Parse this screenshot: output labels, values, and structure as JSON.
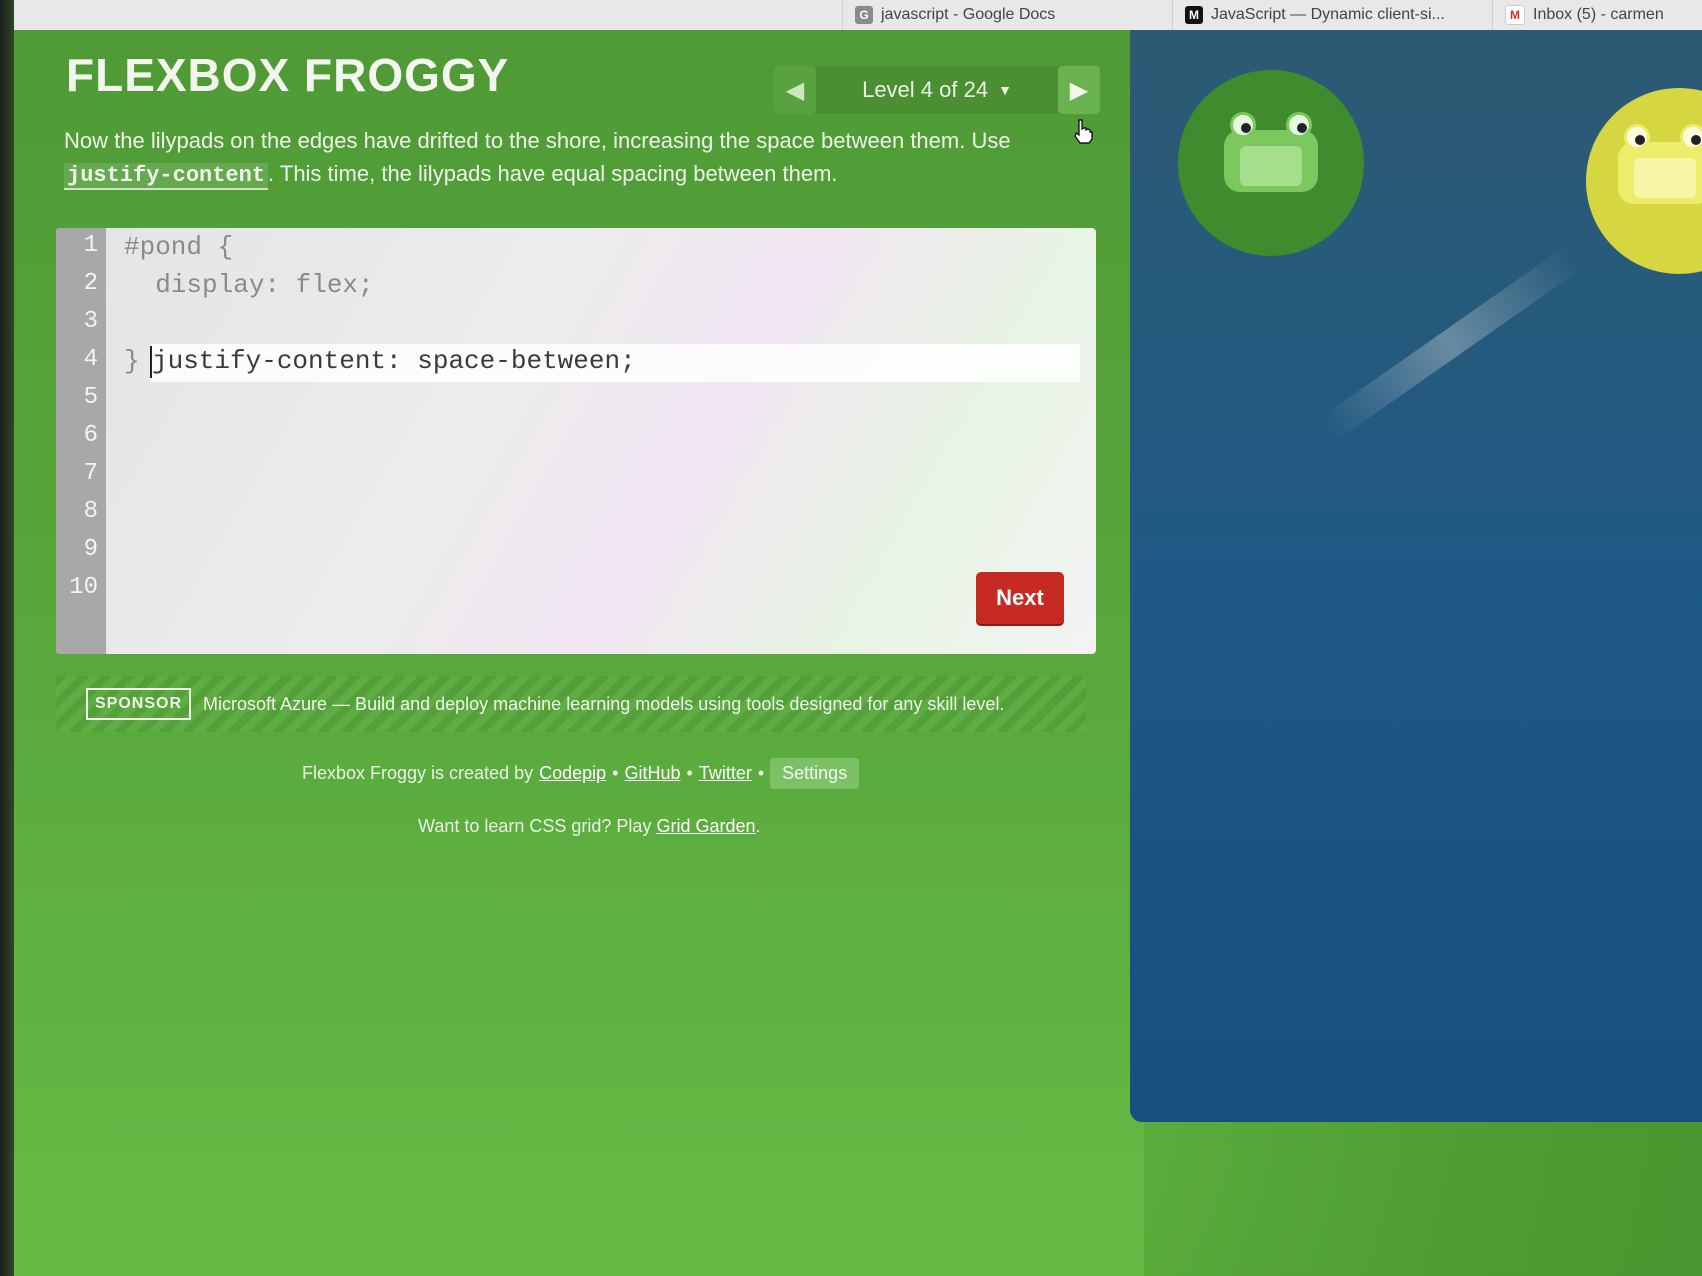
{
  "browser": {
    "tabs": [
      {
        "icon": "google-docs-icon",
        "label": "javascript - Google Docs"
      },
      {
        "icon": "mdn-icon",
        "label": "JavaScript — Dynamic client-si..."
      },
      {
        "icon": "gmail-icon",
        "label": "Inbox (5) - carmen"
      }
    ]
  },
  "game": {
    "title": "FLEXBOX FROGGY",
    "level_label": "Level 4 of 24",
    "prev_icon": "triangle-left-icon",
    "next_icon": "triangle-right-icon",
    "instructions": {
      "part1": "Now the lilypads on the edges have drifted to the shore, increasing the space between them. Use ",
      "code": "justify-content",
      "part2": ". This time, the lilypads have equal spacing between them."
    }
  },
  "editor": {
    "line_numbers": [
      "1",
      "2",
      "3",
      "4",
      "5",
      "6",
      "7",
      "8",
      "9",
      "10"
    ],
    "line1": "#pond {",
    "line2": "  display: flex;",
    "input_value": "justify-content: space-between;",
    "line4": "}",
    "next_button": "Next"
  },
  "sponsor": {
    "badge": "SPONSOR",
    "text": "Microsoft Azure — Build and deploy machine learning models using tools designed for any skill level."
  },
  "footer": {
    "created_by": "Flexbox Froggy is created by",
    "codepip": "Codepip",
    "github": "GitHub",
    "twitter": "Twitter",
    "separator": "•",
    "settings": "Settings",
    "grid_prompt": "Want to learn CSS grid? Play",
    "grid_link": "Grid Garden",
    "period": "."
  },
  "colors": {
    "background_green": "#58a83c",
    "pond_blue": "#1f5a86",
    "next_button_red": "#c62a22",
    "green_frog": "#7bc95e",
    "yellow_frog": "#eded6b"
  }
}
